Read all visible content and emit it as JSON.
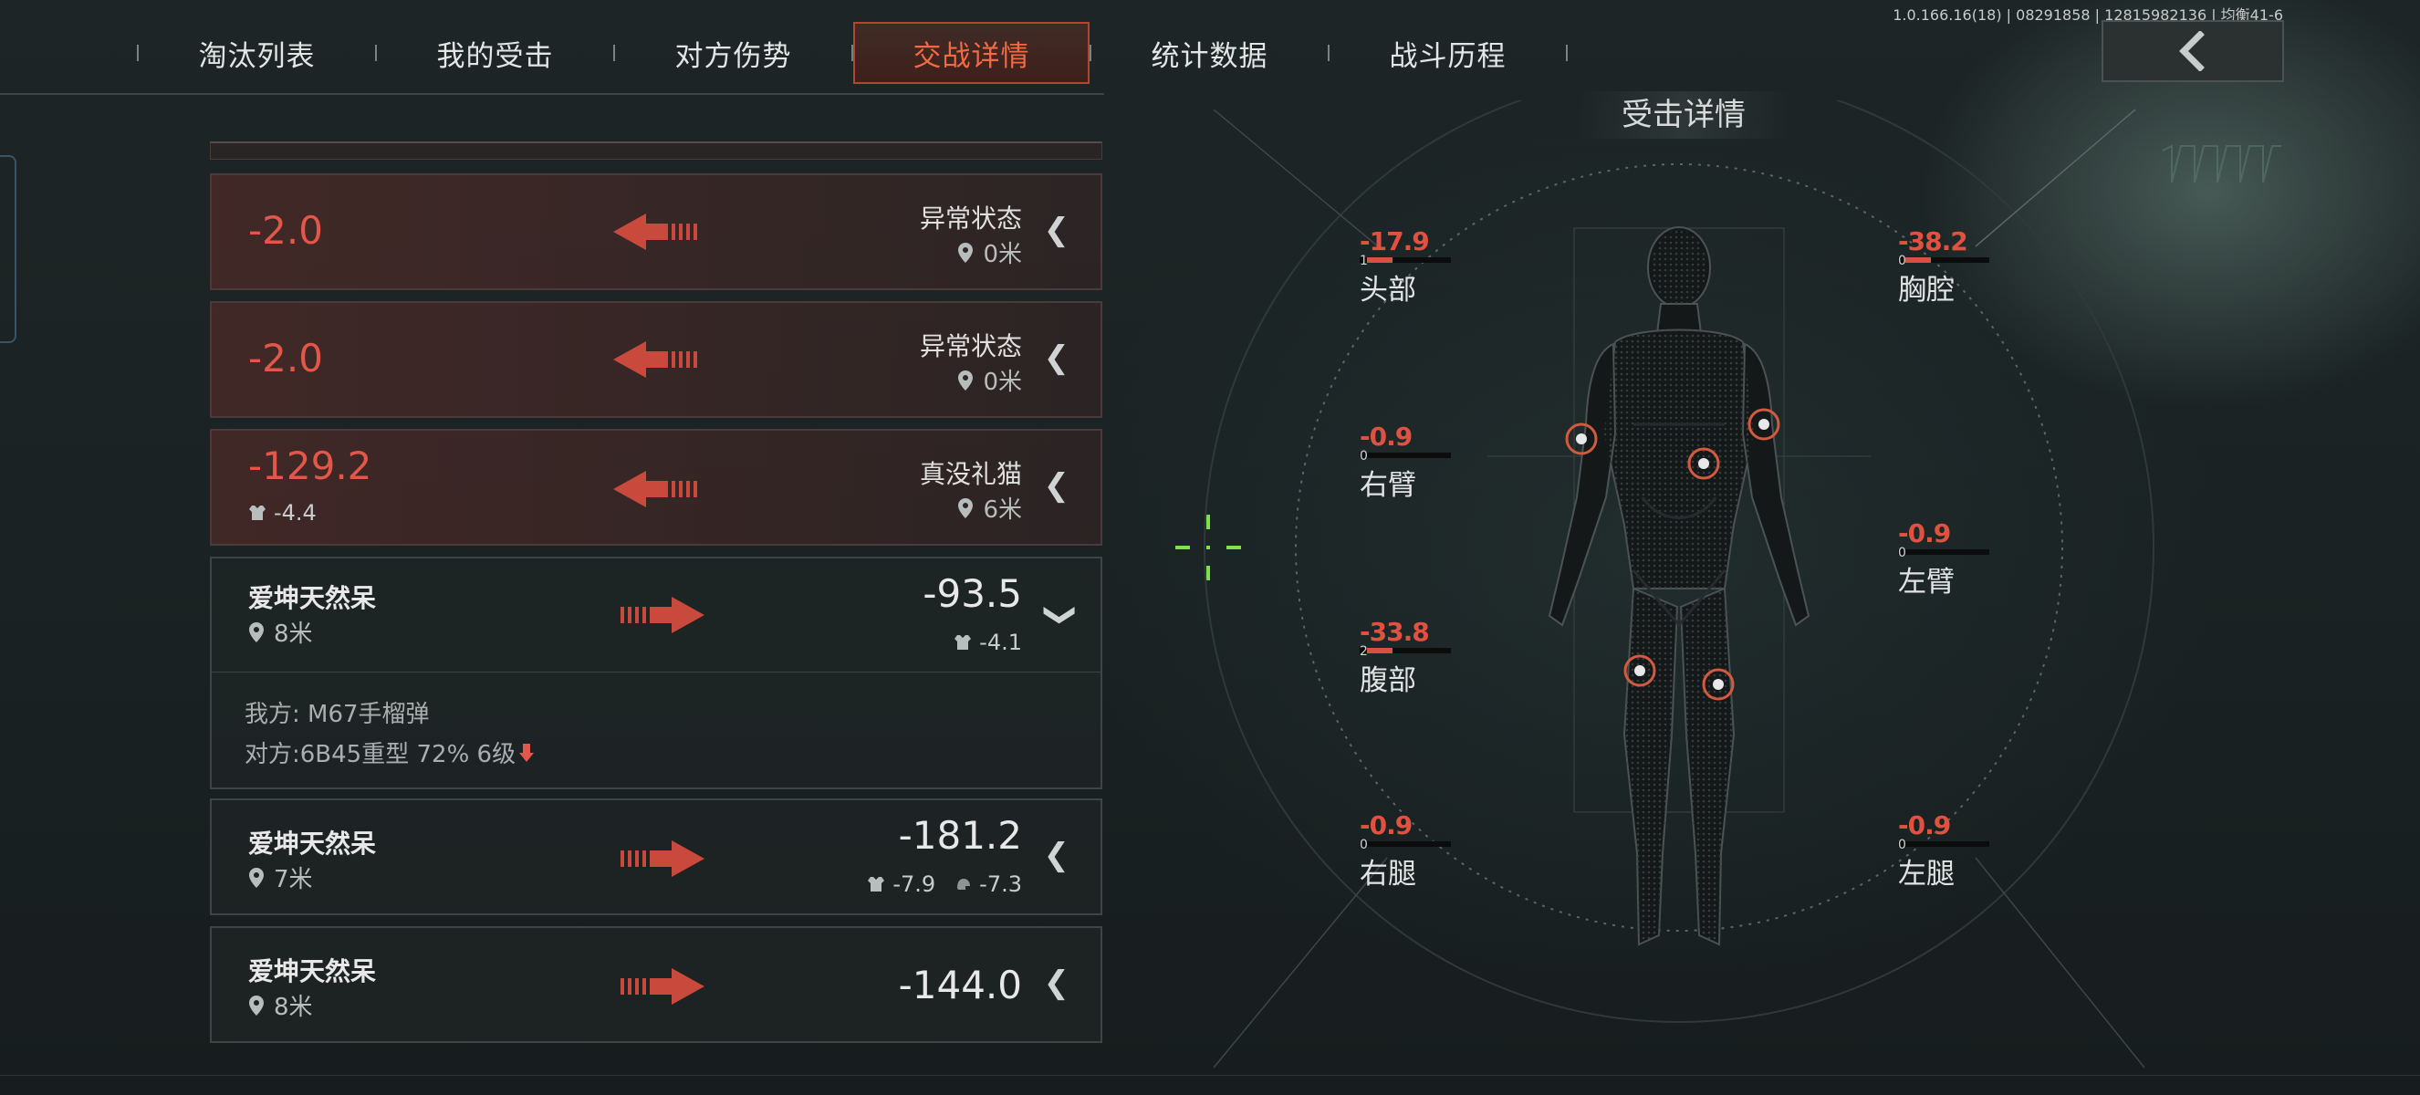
{
  "version": "1.0.166.16(18) | 08291858 | 12815982136 | 均衡41-6",
  "tabs": [
    {
      "label": "淘汰列表",
      "active": false
    },
    {
      "label": "我的受击",
      "active": false
    },
    {
      "label": "对方伤势",
      "active": false
    },
    {
      "label": "交战详情",
      "active": true
    },
    {
      "label": "统计数据",
      "active": false
    },
    {
      "label": "战斗历程",
      "active": false
    }
  ],
  "colors": {
    "accent": "#f26a45",
    "damage": "#e2574a",
    "background": "#1b2324"
  },
  "back_button": {
    "icon": "chevron-left-icon"
  },
  "events": [
    {
      "direction": "incoming",
      "damage": "-2.0",
      "source": "异常状态",
      "distance": "0米",
      "expanded": false
    },
    {
      "direction": "incoming",
      "damage": "-2.0",
      "source": "异常状态",
      "distance": "0米",
      "expanded": false
    },
    {
      "direction": "incoming",
      "damage": "-129.2",
      "armor": "-4.4",
      "source": "真没礼猫",
      "distance": "6米",
      "expanded": false
    },
    {
      "direction": "outgoing",
      "target": "爱坤天然呆",
      "distance": "8米",
      "damage": "-93.5",
      "armor": "-4.1",
      "expanded": true,
      "detail": {
        "mine": "我方: M67手榴弹",
        "theirs": "对方:6B45重型 72% 6级"
      }
    },
    {
      "direction": "outgoing",
      "target": "爱坤天然呆",
      "distance": "7米",
      "damage": "-181.2",
      "armor": "-7.9",
      "helmet": "-7.3",
      "expanded": false
    },
    {
      "direction": "outgoing",
      "target": "爱坤天然呆",
      "distance": "8米",
      "damage": "-144.0",
      "expanded": false
    }
  ],
  "hit_detail": {
    "title": "受击详情",
    "parts": [
      {
        "name": "头部",
        "value": "-17.9",
        "count": "1",
        "fill": 0.3
      },
      {
        "name": "胸腔",
        "value": "-38.2",
        "count": "0",
        "fill": 0.3
      },
      {
        "name": "右臂",
        "value": "-0.9",
        "count": "0",
        "fill": 0
      },
      {
        "name": "左臂",
        "value": "-0.9",
        "count": "0",
        "fill": 0
      },
      {
        "name": "腹部",
        "value": "-33.8",
        "count": "2",
        "fill": 0.3
      },
      {
        "name": "右腿",
        "value": "-0.9",
        "count": "0",
        "fill": 0
      },
      {
        "name": "左腿",
        "value": "-0.9",
        "count": "0",
        "fill": 0
      }
    ]
  }
}
